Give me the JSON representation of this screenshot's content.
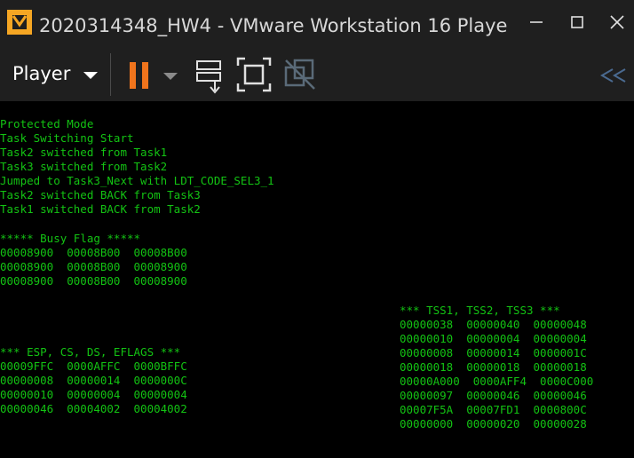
{
  "window": {
    "title": "2020314348_HW4 - VMware Workstation 16 Playe",
    "minimize_icon": "minimize-icon",
    "maximize_icon": "maximize-icon",
    "close_icon": "close-icon"
  },
  "toolbar": {
    "player_label": "Player",
    "pause_icon": "pause-icon",
    "send_ctrl_alt_del_icon": "send-ctrl-alt-del-icon",
    "fullscreen_icon": "fullscreen-icon",
    "unity_icon": "unity-disabled-icon",
    "collapse_icon": "double-chevron-left-icon"
  },
  "colors": {
    "console_text": "#13c313",
    "console_bg": "#000000",
    "chrome_bg": "#1f1f1f",
    "pause_orange": "#f0741c",
    "vmware_icon_orange": "#f5a623"
  },
  "console": {
    "messages": [
      "Protected Mode",
      "Task Switching Start",
      "Task2 switched from Task1",
      "Task3 switched from Task2",
      "Jumped to Task3_Next with LDT_CODE_SEL3_1",
      "Task2 switched BACK from Task3",
      "Task1 switched BACK from Task2"
    ],
    "busy_flag": {
      "header": "***** Busy Flag *****",
      "rows": [
        "00008900  00008B00  00008B00",
        "00008900  00008B00  00008900",
        "00008900  00008B00  00008900"
      ]
    },
    "tss": {
      "header": "*** TSS1, TSS2, TSS3 ***",
      "rows": [
        "00000038  00000040  00000048",
        "00000010  00000004  00000004",
        "00000008  00000014  0000001C",
        "00000018  00000018  00000018",
        "00000A000  0000AFF4  0000C000",
        "00000097  00000046  00000046",
        "00007F5A  00007FD1  0000800C",
        "00000000  00000020  00000028"
      ]
    },
    "regs": {
      "header": "*** ESP, CS, DS, EFLAGS ***",
      "rows": [
        "00009FFC  0000AFFC  0000BFFC",
        "00000008  00000014  0000000C",
        "00000010  00000004  00000004",
        "00000046  00004002  00004002"
      ]
    }
  }
}
